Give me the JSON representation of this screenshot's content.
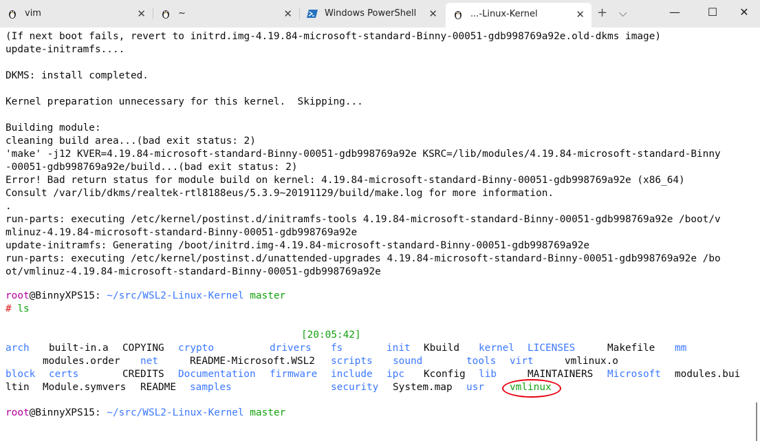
{
  "tabs": [
    {
      "icon": "linux-penguin-icon",
      "label": "vim"
    },
    {
      "icon": "linux-penguin-icon",
      "label": "~"
    },
    {
      "icon": "powershell-icon",
      "label": "Windows PowerShell"
    },
    {
      "icon": "linux-penguin-icon",
      "label": "...-Linux-Kernel"
    }
  ],
  "window": {
    "minimize": "—",
    "maximize": "☐",
    "close": "✕",
    "new_tab": "+",
    "dropdown": "⌵",
    "tab_close": "✕"
  },
  "output_lines": [
    "(If next boot fails, revert to initrd.img-4.19.84-microsoft-standard-Binny-00051-gdb998769a92e.old-dkms image)",
    "update-initramfs....",
    "",
    "DKMS: install completed.",
    "",
    "Kernel preparation unnecessary for this kernel.  Skipping...",
    "",
    "Building module:",
    "cleaning build area...(bad exit status: 2)",
    "'make' -j12 KVER=4.19.84-microsoft-standard-Binny-00051-gdb998769a92e KSRC=/lib/modules/4.19.84-microsoft-standard-Binny",
    "-00051-gdb998769a92e/build...(bad exit status: 2)",
    "Error! Bad return status for module build on kernel: 4.19.84-microsoft-standard-Binny-00051-gdb998769a92e (x86_64)",
    "Consult /var/lib/dkms/realtek-rtl8188eus/5.3.9~20191129/build/make.log for more information.",
    ".",
    "run-parts: executing /etc/kernel/postinst.d/initramfs-tools 4.19.84-microsoft-standard-Binny-00051-gdb998769a92e /boot/v",
    "mlinuz-4.19.84-microsoft-standard-Binny-00051-gdb998769a92e",
    "update-initramfs: Generating /boot/initrd.img-4.19.84-microsoft-standard-Binny-00051-gdb998769a92e",
    "run-parts: executing /etc/kernel/postinst.d/unattended-upgrades 4.19.84-microsoft-standard-Binny-00051-gdb998769a92e /bo",
    "ot/vmlinuz-4.19.84-microsoft-standard-Binny-00051-gdb998769a92e"
  ],
  "prompt": {
    "user": "root",
    "at": "@",
    "host": "BinnyXPS15",
    "colon": ":",
    "path": " ~/src/WSL2-Linux-Kernel",
    "branch": " master",
    "hash": "#",
    "command": " ls"
  },
  "clock": "[20:05:42]",
  "ls": {
    "row1": [
      {
        "text": "arch",
        "type": "dir"
      },
      {
        "text": "built-in.a",
        "type": "file"
      },
      {
        "text": "COPYING",
        "type": "file"
      },
      {
        "text": "crypto",
        "type": "dir"
      },
      {
        "text": "drivers",
        "type": "dir"
      },
      {
        "text": "fs",
        "type": "dir"
      },
      {
        "text": "init",
        "type": "dir"
      },
      {
        "text": "Kbuild",
        "type": "file"
      },
      {
        "text": "kernel",
        "type": "dir"
      },
      {
        "text": "LICENSES",
        "type": "dir"
      },
      {
        "text": "Makefile",
        "type": "file"
      },
      {
        "text": "mm",
        "type": "dir"
      }
    ],
    "row2": [
      {
        "text": "modules.order",
        "type": "file"
      },
      {
        "text": "net",
        "type": "dir"
      },
      {
        "text": "README-Microsoft.WSL2",
        "type": "file"
      },
      {
        "text": "scripts",
        "type": "dir"
      },
      {
        "text": "sound",
        "type": "dir"
      },
      {
        "text": "tools",
        "type": "dir"
      },
      {
        "text": "virt",
        "type": "dir"
      },
      {
        "text": "vmlinux.o",
        "type": "file"
      }
    ],
    "row3": [
      {
        "text": "block",
        "type": "dir"
      },
      {
        "text": "certs",
        "type": "dir"
      },
      {
        "text": "CREDITS",
        "type": "file"
      },
      {
        "text": "Documentation",
        "type": "dir"
      },
      {
        "text": "firmware",
        "type": "dir"
      },
      {
        "text": "include",
        "type": "dir"
      },
      {
        "text": "ipc",
        "type": "dir"
      },
      {
        "text": "Kconfig",
        "type": "file"
      },
      {
        "text": "lib",
        "type": "dir"
      },
      {
        "text": "MAINTAINERS",
        "type": "file"
      },
      {
        "text": "Microsoft",
        "type": "dir"
      },
      {
        "text": "modules.bui",
        "type": "file"
      }
    ],
    "row4": [
      {
        "text": "ltin",
        "type": "file"
      },
      {
        "text": "Module.symvers",
        "type": "file"
      },
      {
        "text": "README",
        "type": "file"
      },
      {
        "text": "samples",
        "type": "dir"
      },
      {
        "text": "security",
        "type": "dir"
      },
      {
        "text": "System.map",
        "type": "file"
      },
      {
        "text": "usr",
        "type": "dir"
      },
      {
        "text": "vmlinux",
        "type": "exec"
      }
    ]
  },
  "colors": {
    "dir": "#3b78ff",
    "exec": "#13a10e",
    "user": "#b4009e",
    "path": "#3b78ff",
    "branch": "#13a10e",
    "hash": "#e02020",
    "highlight": "#e8000f"
  }
}
